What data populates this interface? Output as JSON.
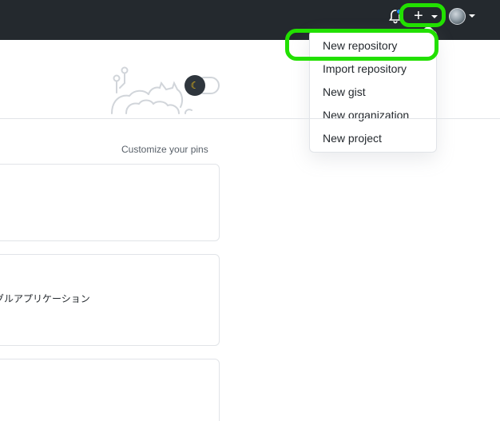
{
  "header": {
    "create_glyph": "+",
    "icons": [
      "bell-icon",
      "plus-icon",
      "chevron-down-icon",
      "avatar"
    ]
  },
  "create_menu": {
    "items": [
      {
        "label": "New repository"
      },
      {
        "label": "Import repository"
      },
      {
        "label": "New gist"
      },
      {
        "label": "New organization"
      },
      {
        "label": "New project"
      }
    ]
  },
  "theme_toggle": {
    "glyph": "☾"
  },
  "pins": {
    "customize_label": "Customize your pins",
    "cards": [
      {
        "description": ""
      },
      {
        "description": "グルアプリケーション"
      },
      {
        "description": ""
      }
    ]
  },
  "colors": {
    "header_bg": "#24292e",
    "highlight": "#22e000",
    "notification_dot": "#2188ff"
  }
}
